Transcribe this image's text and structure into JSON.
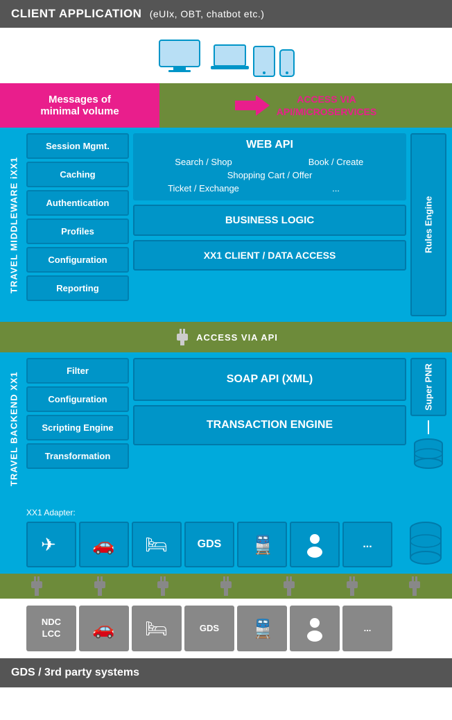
{
  "header": {
    "title": "CLIENT APPLICATION",
    "subtitle": "(eUIx, OBT, chatbot etc.)"
  },
  "messages_box": {
    "line1": "Messages of",
    "line2": "minimal volume"
  },
  "access_via_top": {
    "line1": "ACCESS VIA",
    "line2": "API/MICROSERVICES"
  },
  "middleware": {
    "vertical_label": "TRAVEL MIDDLEWARE iXX1",
    "modules": [
      "Session Mgmt.",
      "Caching",
      "Authentication",
      "Profiles",
      "Configuration",
      "Reporting"
    ],
    "web_api": {
      "title": "WEB API",
      "items": [
        {
          "col1": "Search / Shop",
          "col2": "Book / Create"
        },
        {
          "col1": "Shopping Cart / Offer",
          "col2": ""
        },
        {
          "col1": "Ticket / Exchange",
          "col2": "..."
        }
      ]
    },
    "business_logic": "BUSINESS LOGIC",
    "data_access": "XX1 CLIENT / DATA ACCESS",
    "rules_engine": "Rules Engine"
  },
  "connector_middle": {
    "label": "ACCESS VIA API"
  },
  "backend": {
    "vertical_label": "TRAVEL BACKEND XX1",
    "modules": [
      "Filter",
      "Configuration",
      "Scripting Engine",
      "Transformation"
    ],
    "soap_api": "SOAP API (XML)",
    "transaction_engine": "TRANSACTION ENGINE",
    "super_pnr": "Super PNR",
    "adapter_label": "XX1 Adapter:",
    "adapters": [
      {
        "type": "icon",
        "icon": "✈",
        "name": "flight"
      },
      {
        "type": "icon",
        "icon": "🚗",
        "name": "car"
      },
      {
        "type": "icon",
        "icon": "🛏",
        "name": "hotel"
      },
      {
        "type": "text",
        "icon": "GDS",
        "name": "gds"
      },
      {
        "type": "icon",
        "icon": "🚆",
        "name": "train"
      },
      {
        "type": "icon",
        "icon": "👤",
        "name": "person"
      },
      {
        "type": "text",
        "icon": "...",
        "name": "more"
      }
    ],
    "db_icon": "🗄"
  },
  "bottom_tiles": [
    {
      "type": "text",
      "label": "NDC\nLCC",
      "name": "ndc-lcc"
    },
    {
      "type": "icon",
      "icon": "🚗",
      "name": "car-bottom"
    },
    {
      "type": "icon",
      "icon": "🛏",
      "name": "hotel-bottom"
    },
    {
      "type": "text",
      "label": "GDS",
      "name": "gds-bottom"
    },
    {
      "type": "icon",
      "icon": "🚆",
      "name": "train-bottom"
    },
    {
      "type": "icon",
      "icon": "👤",
      "name": "person-bottom"
    },
    {
      "type": "text",
      "label": "...",
      "name": "more-bottom"
    }
  ],
  "gds_footer": {
    "label": "GDS / 3rd party systems"
  }
}
